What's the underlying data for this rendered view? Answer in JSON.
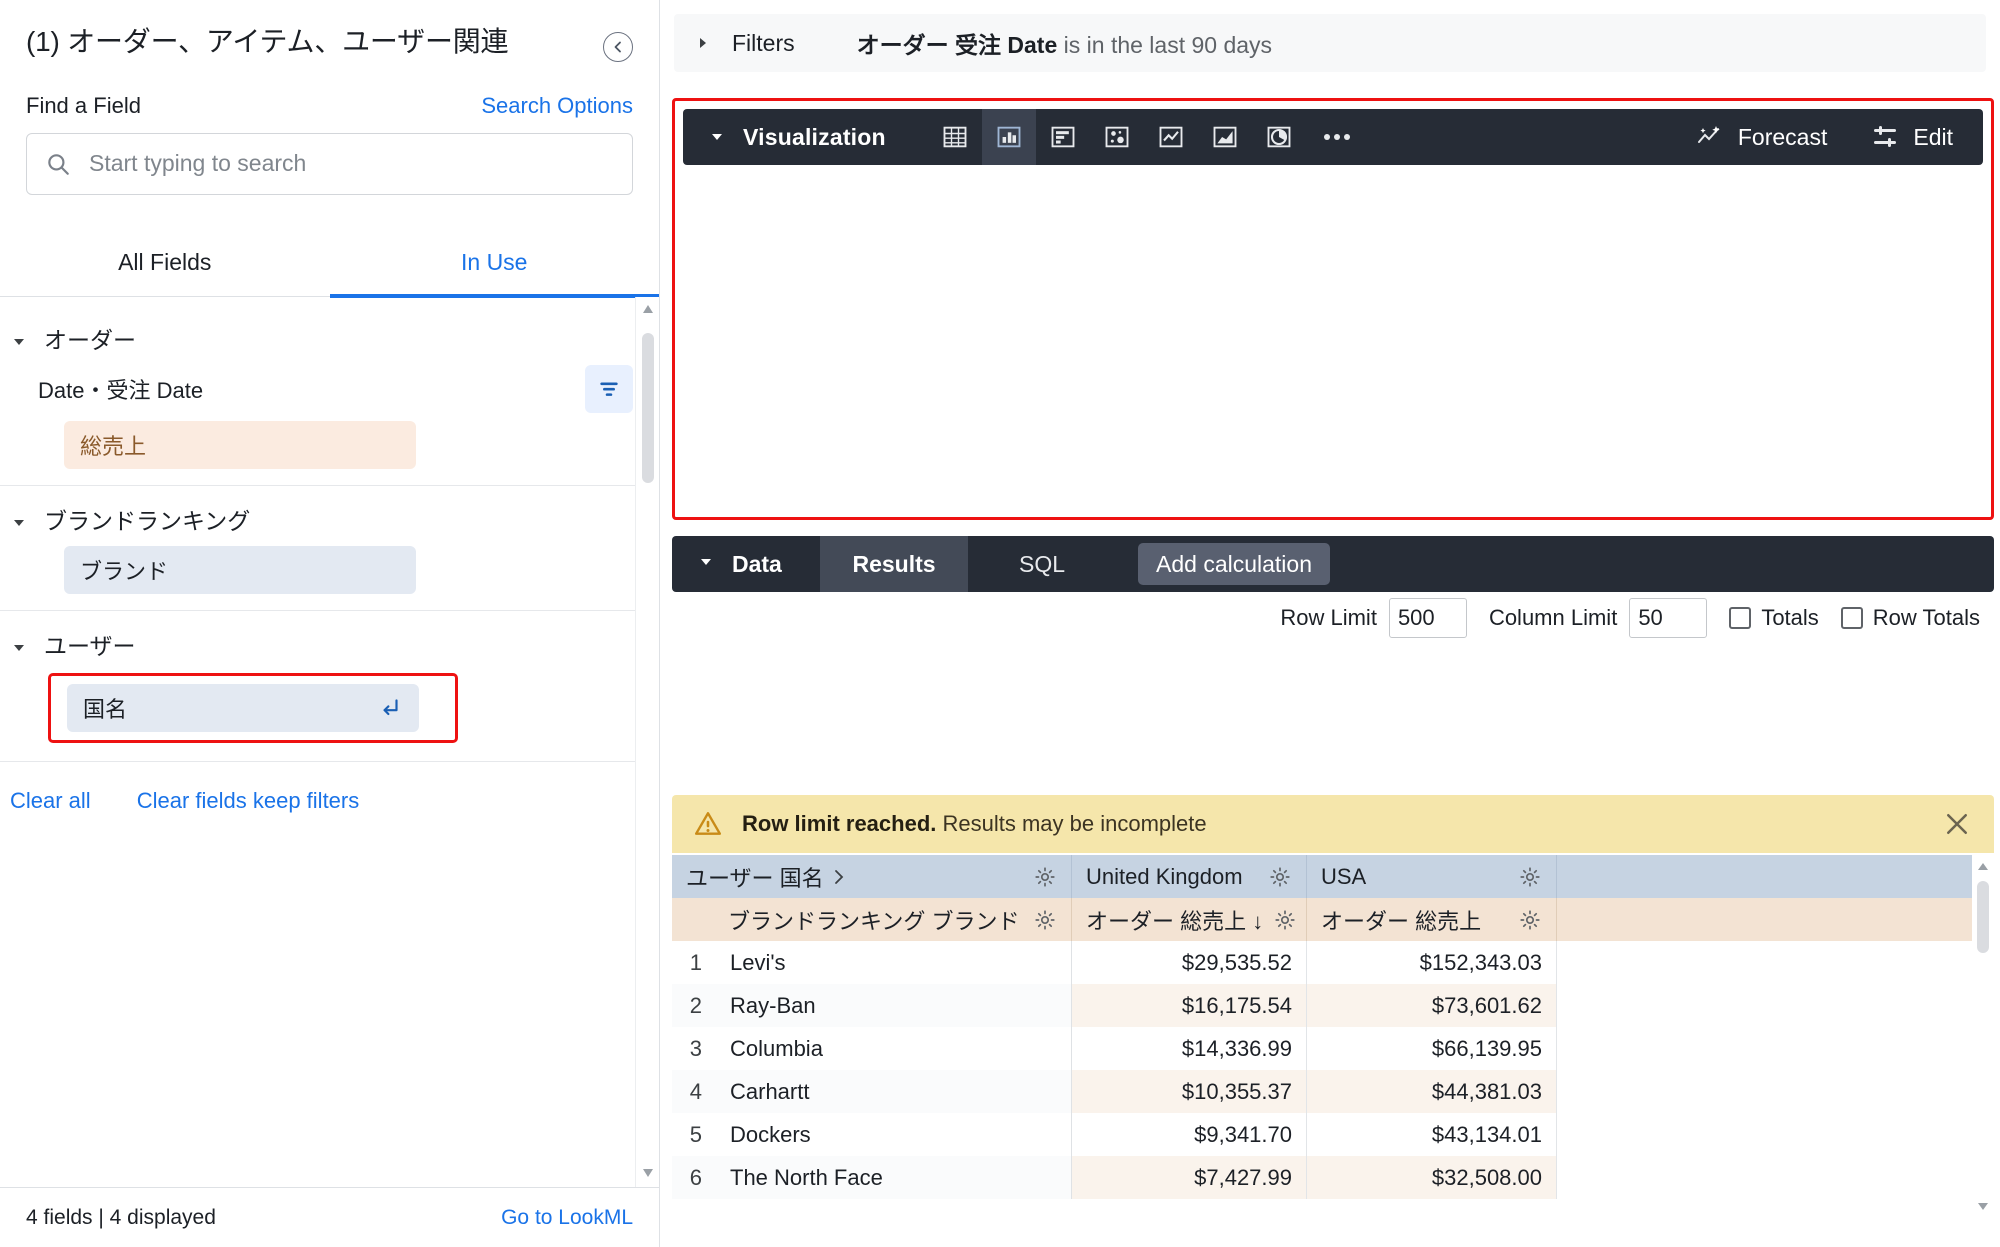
{
  "sidebar": {
    "title": "(1) オーダー、アイテム、ユーザー関連",
    "collapse_icon": "chevron-left-circle-icon",
    "find_label": "Find a Field",
    "search_options_label": "Search Options",
    "search": {
      "value": "",
      "placeholder": "Start typing to search",
      "icon": "search-icon"
    },
    "tabs": [
      {
        "label": "All Fields",
        "active": false
      },
      {
        "label": "In Use",
        "active": true
      }
    ],
    "groups": [
      {
        "name": "オーダー",
        "fields": [
          {
            "label": "Date・受注 Date",
            "type": "plain",
            "filter_icon": "filter-icon"
          },
          {
            "label": "総売上",
            "type": "measure"
          }
        ]
      },
      {
        "name": "ブランドランキング",
        "fields": [
          {
            "label": "ブランド",
            "type": "dimension"
          }
        ]
      },
      {
        "name": "ユーザー",
        "fields": [
          {
            "label": "国名",
            "type": "dimension",
            "pivot_icon": "pivot-enter-icon",
            "highlighted": true
          }
        ]
      }
    ],
    "clear_all_label": "Clear all",
    "clear_fields_label": "Clear fields keep filters",
    "footer": {
      "count_text": "4 fields | 4 displayed",
      "lookml_label": "Go to LookML"
    }
  },
  "filters": {
    "label": "Filters",
    "expression_field": "オーダー 受注 Date",
    "expression_rest": "is in the last 90 days"
  },
  "visualization": {
    "label": "Visualization",
    "chart_types": [
      {
        "name": "table-chart-icon",
        "active": false
      },
      {
        "name": "column-chart-icon",
        "active": true
      },
      {
        "name": "bar-chart-icon",
        "active": false
      },
      {
        "name": "scatter-chart-icon",
        "active": false
      },
      {
        "name": "line-chart-icon",
        "active": false
      },
      {
        "name": "area-chart-icon",
        "active": false
      },
      {
        "name": "pie-chart-icon",
        "active": false
      },
      {
        "name": "more-options-icon",
        "active": false
      }
    ],
    "forecast_label": "Forecast",
    "edit_label": "Edit"
  },
  "data_panel": {
    "label": "Data",
    "tabs": [
      {
        "label": "Results",
        "active": true
      },
      {
        "label": "SQL",
        "active": false
      }
    ],
    "add_calculation_label": "Add calculation",
    "row_limit_label": "Row Limit",
    "row_limit_value": "500",
    "column_limit_label": "Column Limit",
    "column_limit_value": "50",
    "totals_label": "Totals",
    "row_totals_label": "Row Totals",
    "totals_checked": false,
    "row_totals_checked": false
  },
  "warning": {
    "icon": "warning-triangle-icon",
    "bold_text": "Row limit reached.",
    "text": " Results may be incomplete",
    "close_icon": "close-icon"
  },
  "results_table": {
    "pivot_header_label": "ユーザー 国名",
    "pivot_columns": [
      "United Kingdom",
      "USA"
    ],
    "dimension_header_label": "ブランドランキング ブランド",
    "measure_headers": [
      "オーダー 総売上 ↓",
      "オーダー 総売上"
    ],
    "rows": [
      {
        "num": "1",
        "brand": "Levi's",
        "values": [
          "$29,535.52",
          "$152,343.03"
        ]
      },
      {
        "num": "2",
        "brand": "Ray-Ban",
        "values": [
          "$16,175.54",
          "$73,601.62"
        ]
      },
      {
        "num": "3",
        "brand": "Columbia",
        "values": [
          "$14,336.99",
          "$66,139.95"
        ]
      },
      {
        "num": "4",
        "brand": "Carhartt",
        "values": [
          "$10,355.37",
          "$44,381.03"
        ]
      },
      {
        "num": "5",
        "brand": "Dockers",
        "values": [
          "$9,341.70",
          "$43,134.01"
        ]
      },
      {
        "num": "6",
        "brand": "The North Face",
        "values": [
          "$7,427.99",
          "$32,508.00"
        ]
      }
    ]
  },
  "colors": {
    "accent_blue": "#1a73e8",
    "annotation_red": "#ee1111",
    "panel_dark": "#262c36",
    "warning_bg": "#f5e6ab",
    "measure_chip": "#fbebe0",
    "dimension_chip": "#e3e9f2",
    "pivot_header": "#c6d3e2",
    "measure_header": "#f3e3d3"
  }
}
